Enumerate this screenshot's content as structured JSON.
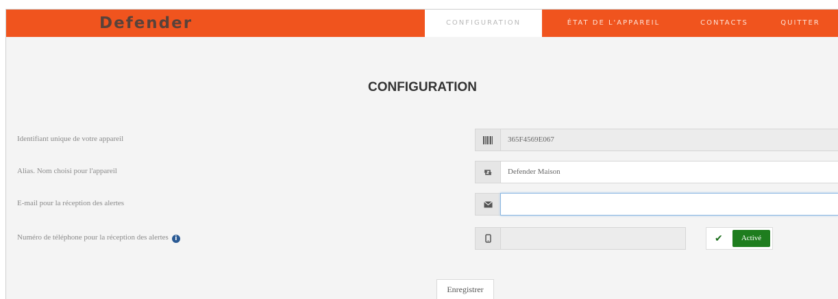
{
  "header": {
    "brand": "Defender",
    "nav": [
      {
        "label": "CONFIGURATION",
        "active": true
      },
      {
        "label": "ÉTAT DE L'APPAREIL",
        "active": false
      },
      {
        "label": "CONTACTS",
        "active": false
      },
      {
        "label": "QUITTER",
        "active": false
      }
    ]
  },
  "main": {
    "title": "CONFIGURATION",
    "fields": [
      {
        "label": "Identifiant unique de votre appareil",
        "icon": "barcode-icon",
        "value": "365F4569E067",
        "readonly": true
      },
      {
        "label": "Alias. Nom choisi pour l'appareil",
        "icon": "retweet-icon",
        "value": "Defender Maison",
        "readonly": false
      },
      {
        "label": "E-mail pour la réception des alertes",
        "icon": "envelope-icon",
        "value": "",
        "readonly": false
      },
      {
        "label": "Numéro de téléphone pour la réception des alertes",
        "icon": "phone-icon",
        "value": "",
        "readonly": true
      }
    ],
    "sms_toggle": {
      "label": "Activé",
      "state": "on"
    },
    "save_label": "Enregistrer"
  },
  "colors": {
    "navbar": "#f0541e",
    "active_badge": "#1e7d1e",
    "info_icon": "#2a5a94"
  }
}
